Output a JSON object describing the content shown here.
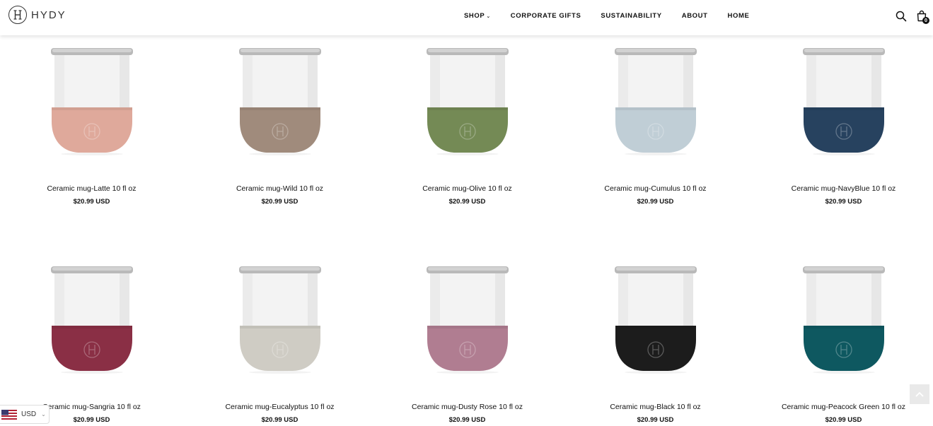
{
  "header": {
    "logo_text": "HYDY",
    "logo_mark": "H",
    "nav": [
      {
        "label": "SHOP",
        "has_caret": true
      },
      {
        "label": "CORPORATE GIFTS",
        "has_caret": false
      },
      {
        "label": "SUSTAINABILITY",
        "has_caret": false
      },
      {
        "label": "ABOUT",
        "has_caret": false
      },
      {
        "label": "HOME",
        "has_caret": false
      }
    ],
    "cart_count": "0",
    "icons": [
      "search-icon",
      "cart-icon"
    ]
  },
  "products": [
    {
      "name": "Ceramic mug-Latte 10 fl oz",
      "price": "$20.99 USD",
      "sleeve_color": "#dfa99b"
    },
    {
      "name": "Ceramic mug-Wild 10 fl oz",
      "price": "$20.99 USD",
      "sleeve_color": "#a08b7c"
    },
    {
      "name": "Ceramic mug-Olive 10 fl oz",
      "price": "$20.99 USD",
      "sleeve_color": "#748a55"
    },
    {
      "name": "Ceramic mug-Cumulus 10 fl oz",
      "price": "$20.99 USD",
      "sleeve_color": "#c0ced6"
    },
    {
      "name": "Ceramic mug-NavyBlue 10 fl oz",
      "price": "$20.99 USD",
      "sleeve_color": "#27425f"
    },
    {
      "name": "Ceramic mug-Sangria 10 fl oz",
      "price": "$20.99 USD",
      "sleeve_color": "#8a2f45"
    },
    {
      "name": "Ceramic mug-Eucalyptus 10 fl oz",
      "price": "$20.99 USD",
      "sleeve_color": "#cfccc4"
    },
    {
      "name": "Ceramic mug-Dusty Rose 10 fl oz",
      "price": "$20.99 USD",
      "sleeve_color": "#b07d91"
    },
    {
      "name": "Ceramic mug-Black 10 fl oz",
      "price": "$20.99 USD",
      "sleeve_color": "#1c1c1c"
    },
    {
      "name": "Ceramic mug-Peacock Green 10 fl oz",
      "price": "$20.99 USD",
      "sleeve_color": "#0e5860"
    }
  ],
  "currency": {
    "code": "USD",
    "flag": "us-flag-icon"
  },
  "back_to_top": {
    "icon": "chevron-up-icon"
  }
}
